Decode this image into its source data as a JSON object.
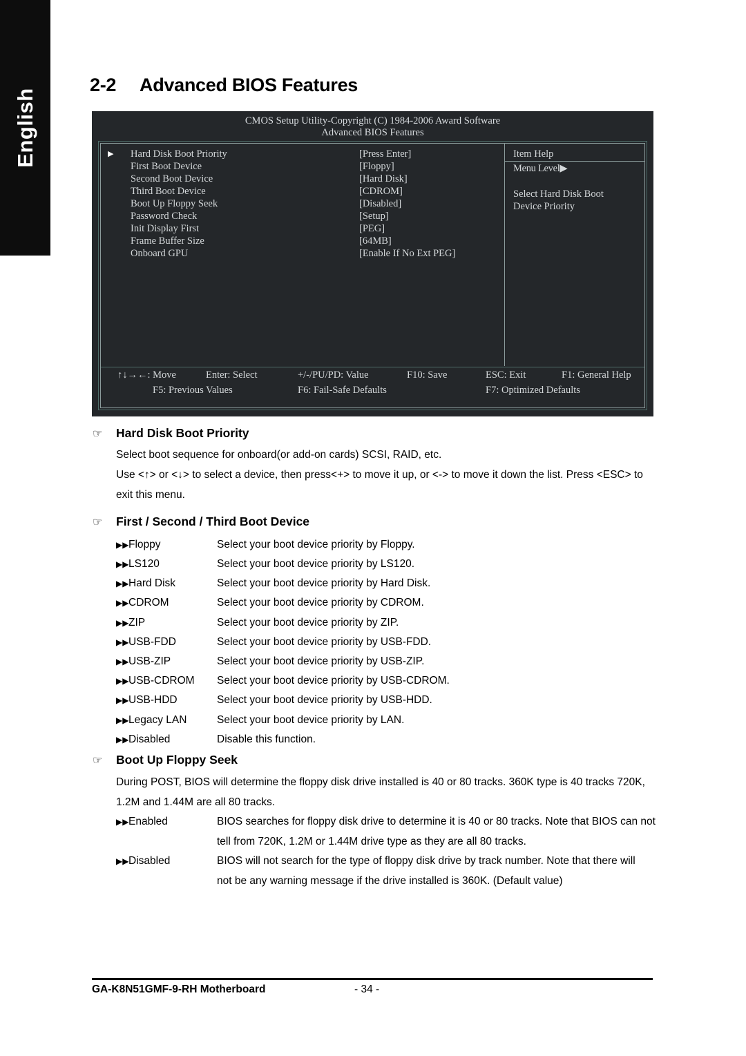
{
  "sidebar": {
    "language_label": "English"
  },
  "heading": {
    "section_number": "2-2",
    "title": "Advanced BIOS Features"
  },
  "bios": {
    "title_line1": "CMOS Setup Utility-Copyright (C) 1984-2006 Award Software",
    "title_line2": "Advanced BIOS Features",
    "selector_arrow": "▶",
    "options": [
      {
        "label": "Hard Disk Boot Priority",
        "value": "[Press Enter]",
        "selected": true
      },
      {
        "label": "First Boot Device",
        "value": "[Floppy]",
        "selected": false
      },
      {
        "label": "Second Boot Device",
        "value": "[Hard Disk]",
        "selected": false
      },
      {
        "label": "Third Boot Device",
        "value": "[CDROM]",
        "selected": false
      },
      {
        "label": "Boot Up Floppy Seek",
        "value": "[Disabled]",
        "selected": false
      },
      {
        "label": "Password Check",
        "value": "[Setup]",
        "selected": false
      },
      {
        "label": "Init Display First",
        "value": "[PEG]",
        "selected": false
      },
      {
        "label": "Frame Buffer Size",
        "value": "[64MB]",
        "selected": false
      },
      {
        "label": "Onboard GPU",
        "value": "[Enable If No Ext PEG]",
        "selected": false
      }
    ],
    "help": {
      "title": "Item Help",
      "menu_level": "Menu Level▶",
      "text_line1": "Select Hard Disk Boot",
      "text_line2": "Device Priority"
    },
    "footer": {
      "move": "↑↓→←: Move",
      "enter": "Enter: Select",
      "value": "+/-/PU/PD: Value",
      "f10": "F10: Save",
      "esc": "ESC: Exit",
      "f1": "F1: General Help",
      "f5": "F5: Previous Values",
      "f6": "F6: Fail-Safe Defaults",
      "f7": "F7: Optimized Defaults"
    },
    "colors": {
      "background": "#24272a",
      "text": "#d4d8da",
      "border_outer": "#4f6e6a",
      "border_inner": "#8b9b9b"
    }
  },
  "glyphs": {
    "hand": "☞",
    "double_triangle": "▶▶"
  },
  "sections": [
    {
      "title": "Hard Disk Boot Priority",
      "paragraphs": [
        "Select boot sequence for onboard(or add-on cards) SCSI, RAID, etc.",
        "Use <↑> or <↓> to select a device, then press<+> to move it up, or <-> to move it down the list. Press <ESC> to exit this menu."
      ]
    },
    {
      "title": "First / Second / Third Boot Device",
      "options": [
        {
          "name": "Floppy",
          "desc": "Select your boot device priority by Floppy."
        },
        {
          "name": "LS120",
          "desc": "Select your boot device priority by LS120."
        },
        {
          "name": "Hard Disk",
          "desc": "Select your boot device priority by Hard Disk."
        },
        {
          "name": "CDROM",
          "desc": "Select your boot device priority by CDROM."
        },
        {
          "name": "ZIP",
          "desc": "Select your boot device priority by ZIP."
        },
        {
          "name": "USB-FDD",
          "desc": "Select your boot device priority by USB-FDD."
        },
        {
          "name": "USB-ZIP",
          "desc": "Select your boot device priority by USB-ZIP."
        },
        {
          "name": "USB-CDROM",
          "desc": "Select your boot device priority by USB-CDROM."
        },
        {
          "name": "USB-HDD",
          "desc": "Select your boot device priority by USB-HDD."
        },
        {
          "name": "Legacy LAN",
          "desc": "Select your boot device priority by LAN."
        },
        {
          "name": "Disabled",
          "desc": "Disable this function."
        }
      ]
    },
    {
      "title": "Boot Up Floppy Seek",
      "paragraphs": [
        "During POST, BIOS will determine the floppy disk drive installed is 40 or 80 tracks. 360K type is 40 tracks 720K, 1.2M and 1.44M are all 80 tracks."
      ],
      "options": [
        {
          "name": "Enabled",
          "desc": "BIOS searches for floppy disk drive to determine it is 40 or 80 tracks. Note that BIOS can not tell from 720K, 1.2M or 1.44M drive type as they are all 80 tracks."
        },
        {
          "name": "Disabled",
          "desc": "BIOS will not search for the type of floppy disk drive by track number. Note that there will not be any warning message if the drive installed is 360K. (Default value)"
        }
      ]
    }
  ],
  "page_footer": {
    "product": "GA-K8N51GMF-9-RH Motherboard",
    "page_number": "- 34 -"
  }
}
